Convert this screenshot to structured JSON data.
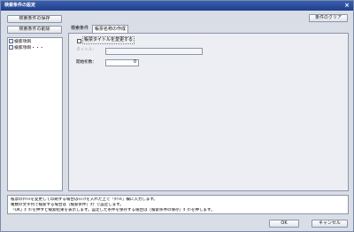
{
  "window": {
    "title": "検索条件の設定",
    "close_glyph": "×"
  },
  "toolbar": {
    "save_label": "検索条件の保存",
    "delete_label": "検索条件の削除",
    "clear_label": "条件のクリア"
  },
  "tree": {
    "items": [
      {
        "label": "検索項目",
        "icon": "tree-node-icon"
      },
      {
        "label": "検索項目・・・",
        "icon": "tree-node-icon"
      }
    ]
  },
  "tabs": [
    {
      "label": "検索条件",
      "active": false
    },
    {
      "label": "帳票名称の作成",
      "active": true
    }
  ],
  "form": {
    "change_title_label": "帳票タイトルを変更する",
    "change_title_checked": false,
    "title_label": "タイトル：",
    "title_value": "",
    "start_row_label": "開始桁数：",
    "start_row_value": "0"
  },
  "help": {
    "lines": [
      "帳票のﾀｲﾄﾙを変更して印刷する場合はﾁｪｯｸを入れた上で「ﾀｲﾄﾙ」欄に入力します。",
      "複数の文字列で検索する場合は［検索条件］ﾀﾌﾞで設定します。",
      "「OK」ﾎﾞﾀﾝを押すと検索結果を表示します。設定した条件を保存する場合は［検索条件の保存］ﾎﾞﾀﾝを押します。"
    ]
  },
  "footer": {
    "ok_label": "OK",
    "cancel_label": "キャンセル"
  }
}
